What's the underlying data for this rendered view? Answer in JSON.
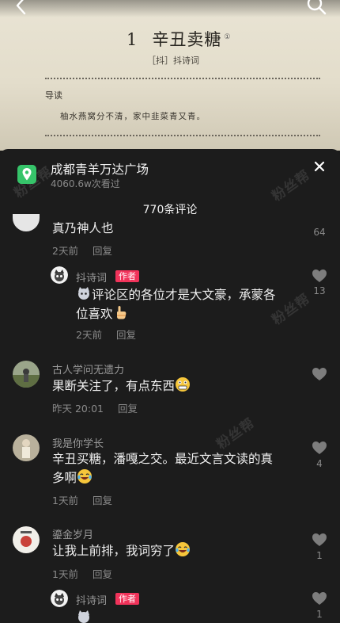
{
  "background": {
    "book_title_num": "1",
    "book_title": "辛丑卖糖",
    "book_title_mark": "①",
    "book_author": "［抖］抖诗词",
    "guide_label": "导读",
    "guide_text": "柚水燕窝分不清，家中韭菜青又青。"
  },
  "location": {
    "name": "成都青羊万达广场",
    "views": "4060.6w次看过"
  },
  "comment_count": "770条评论",
  "watermark": "粉丝帮",
  "comments": [
    {
      "text": "真乃神人也",
      "time": "2天前",
      "reply": "回复",
      "likes": "64"
    },
    {
      "name": "抖诗词",
      "badge": "作者",
      "text_line1": "评论区的各位才是大文豪，承蒙各",
      "text_line2": "位喜欢",
      "time": "2天前",
      "reply": "回复",
      "likes": "13"
    },
    {
      "name": "古人学问无遗力",
      "text": "果断关注了，有点东西",
      "time": "昨天 20:01",
      "reply": "回复"
    },
    {
      "name": "我是你学长",
      "text_line1": "辛丑买糖，潘嘎之交。最近文言文读的真",
      "text_line2": "多啊",
      "time": "1天前",
      "reply": "回复",
      "likes": "4"
    },
    {
      "name": "鎏金岁月",
      "text": "让我上前排，我词穷了",
      "time": "1天前",
      "reply": "回复",
      "likes": "1"
    },
    {
      "name": "抖诗词",
      "badge": "作者",
      "likes": "1"
    }
  ],
  "colors": {
    "sheet_bg": "#1c1c1c",
    "author_badge": "#f0335a",
    "location_icon": "#36c46a"
  }
}
